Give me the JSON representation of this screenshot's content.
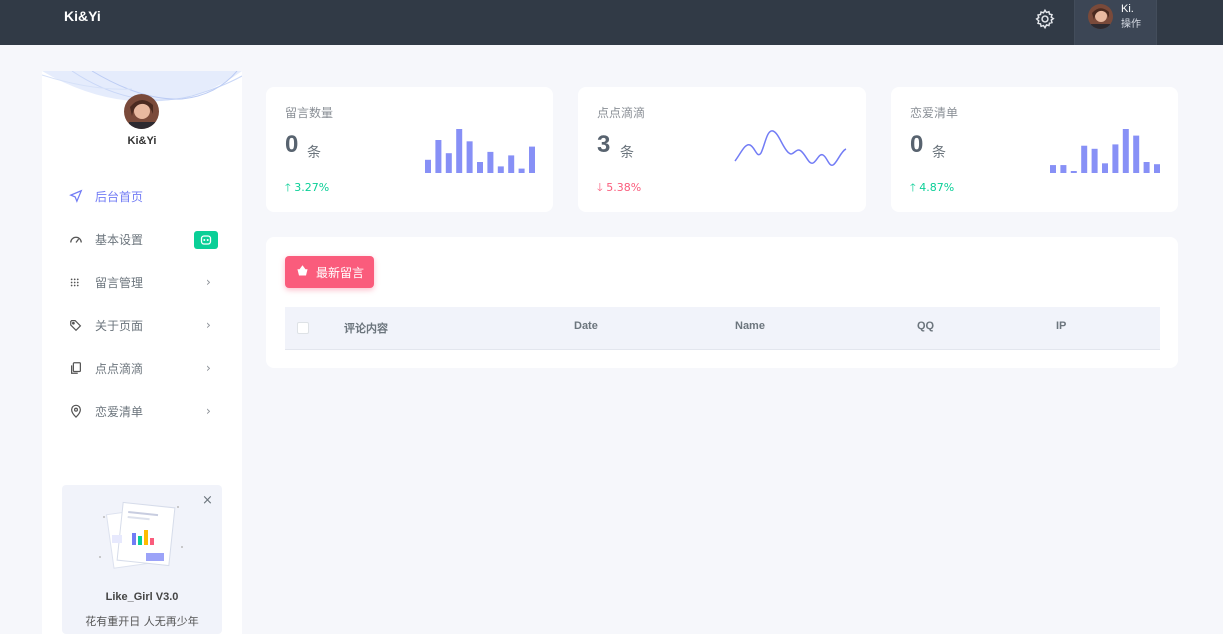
{
  "topbar": {
    "brand": "Ki&Yi",
    "user_name": "Ki.",
    "user_role": "操作"
  },
  "sidebar": {
    "profile_name": "Ki&Yi",
    "items": [
      {
        "label": "后台首页",
        "icon": "send-icon",
        "active": true
      },
      {
        "label": "基本设置",
        "icon": "speedometer-icon",
        "badge_icon": "robot-icon"
      },
      {
        "label": "留言管理",
        "icon": "grid-dots-icon",
        "arrow": "›"
      },
      {
        "label": "关于页面",
        "icon": "tag-icon",
        "arrow": "›"
      },
      {
        "label": "点点滴滴",
        "icon": "copy-icon",
        "arrow": "›"
      },
      {
        "label": "恋爱清单",
        "icon": "map-pin-icon",
        "arrow": "›"
      }
    ],
    "promo": {
      "close": "×",
      "title": "Like_Girl V3.0",
      "subtitle": "花有重开日 人无再少年"
    }
  },
  "stats": [
    {
      "title": "留言数量",
      "value": "0",
      "unit": "条",
      "change": "3.27%",
      "direction": "up",
      "chart": "bar",
      "bars": [
        0.3,
        0.75,
        0.45,
        1.0,
        0.72,
        0.25,
        0.48,
        0.15,
        0.4,
        0.1,
        0.6
      ]
    },
    {
      "title": "点点滴滴",
      "value": "3",
      "unit": "条",
      "change": "5.38%",
      "direction": "down",
      "chart": "line"
    },
    {
      "title": "恋爱清单",
      "value": "0",
      "unit": "条",
      "change": "4.87%",
      "direction": "up",
      "chart": "bar",
      "bars": [
        0.18,
        0.18,
        0.0,
        0.62,
        0.55,
        0.22,
        0.65,
        1.0,
        0.85,
        0.25,
        0.2
      ]
    }
  ],
  "colors": {
    "accent": "#727cf5",
    "success": "#0acf97",
    "danger": "#fa5c7c",
    "topbar": "#313a46"
  },
  "table": {
    "new_button": "最新留言",
    "columns": [
      "评论内容",
      "Date",
      "Name",
      "QQ",
      "IP"
    ]
  }
}
